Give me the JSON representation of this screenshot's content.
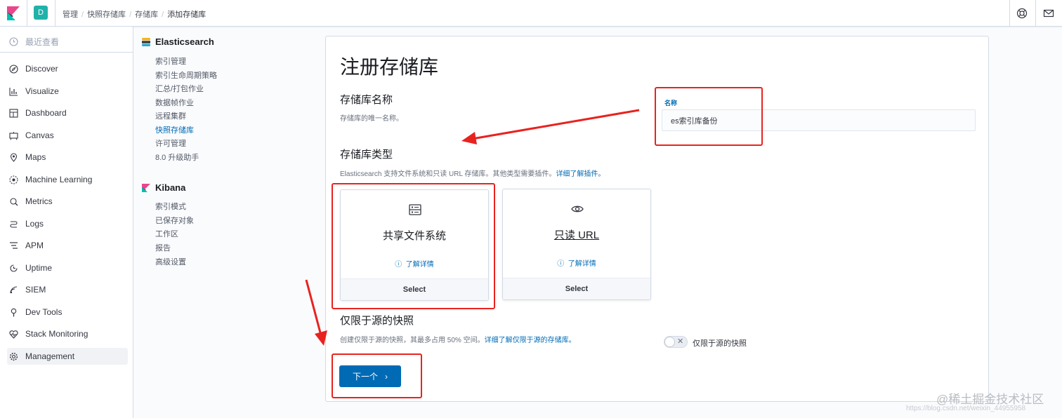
{
  "header": {
    "space_initial": "D",
    "breadcrumbs": [
      "管理",
      "快照存储库",
      "存储库",
      "添加存储库"
    ]
  },
  "leftnav": {
    "recent": "最近查看",
    "items": [
      {
        "label": "Discover",
        "icon": "compass-icon"
      },
      {
        "label": "Visualize",
        "icon": "visualize-icon"
      },
      {
        "label": "Dashboard",
        "icon": "dashboard-icon"
      },
      {
        "label": "Canvas",
        "icon": "canvas-icon"
      },
      {
        "label": "Maps",
        "icon": "maps-icon"
      },
      {
        "label": "Machine Learning",
        "icon": "ml-icon"
      },
      {
        "label": "Metrics",
        "icon": "metrics-icon"
      },
      {
        "label": "Logs",
        "icon": "logs-icon"
      },
      {
        "label": "APM",
        "icon": "apm-icon"
      },
      {
        "label": "Uptime",
        "icon": "uptime-icon"
      },
      {
        "label": "SIEM",
        "icon": "siem-icon"
      },
      {
        "label": "Dev Tools",
        "icon": "devtools-icon"
      },
      {
        "label": "Stack Monitoring",
        "icon": "monitoring-icon"
      },
      {
        "label": "Management",
        "icon": "gear-icon"
      }
    ]
  },
  "subnav": {
    "elasticsearch_title": "Elasticsearch",
    "elasticsearch_links": [
      "索引管理",
      "索引生命周期策略",
      "汇总/打包作业",
      "数据帧作业",
      "远程集群",
      "快照存储库",
      "许可管理",
      "8.0 升级助手"
    ],
    "kibana_title": "Kibana",
    "kibana_links": [
      "索引模式",
      "已保存对象",
      "工作区",
      "报告",
      "高级设置"
    ]
  },
  "main": {
    "title": "注册存储库",
    "name_section_title": "存储库名称",
    "name_section_desc": "存储库的唯一名称。",
    "name_label": "名称",
    "name_value": "es索引库备份",
    "type_section_title": "存储库类型",
    "type_section_desc": "Elasticsearch 支持文件系统和只读 URL 存储库。其他类型需要插件。",
    "type_section_link": "详细了解插件。",
    "cards": [
      {
        "title": "共享文件系统",
        "more": "了解详情",
        "select": "Select",
        "icon": "filesystem-icon"
      },
      {
        "title": "只读 URL",
        "more": "了解详情",
        "select": "Select",
        "icon": "eye-icon"
      }
    ],
    "source_section_title": "仅限于源的快照",
    "source_section_desc": "创建仅限于源的快照，其最多占用 50% 空间。",
    "source_section_link": "详细了解仅限于源的存储库。",
    "toggle_label": "仅限于源的快照",
    "next_label": "下一个"
  },
  "watermark": "@稀土掘金技术社区",
  "watermark_url": "https://blog.csdn.net/weixin_44955958",
  "colors": {
    "accent": "#006bb4",
    "annotation_red": "#e8231f"
  }
}
